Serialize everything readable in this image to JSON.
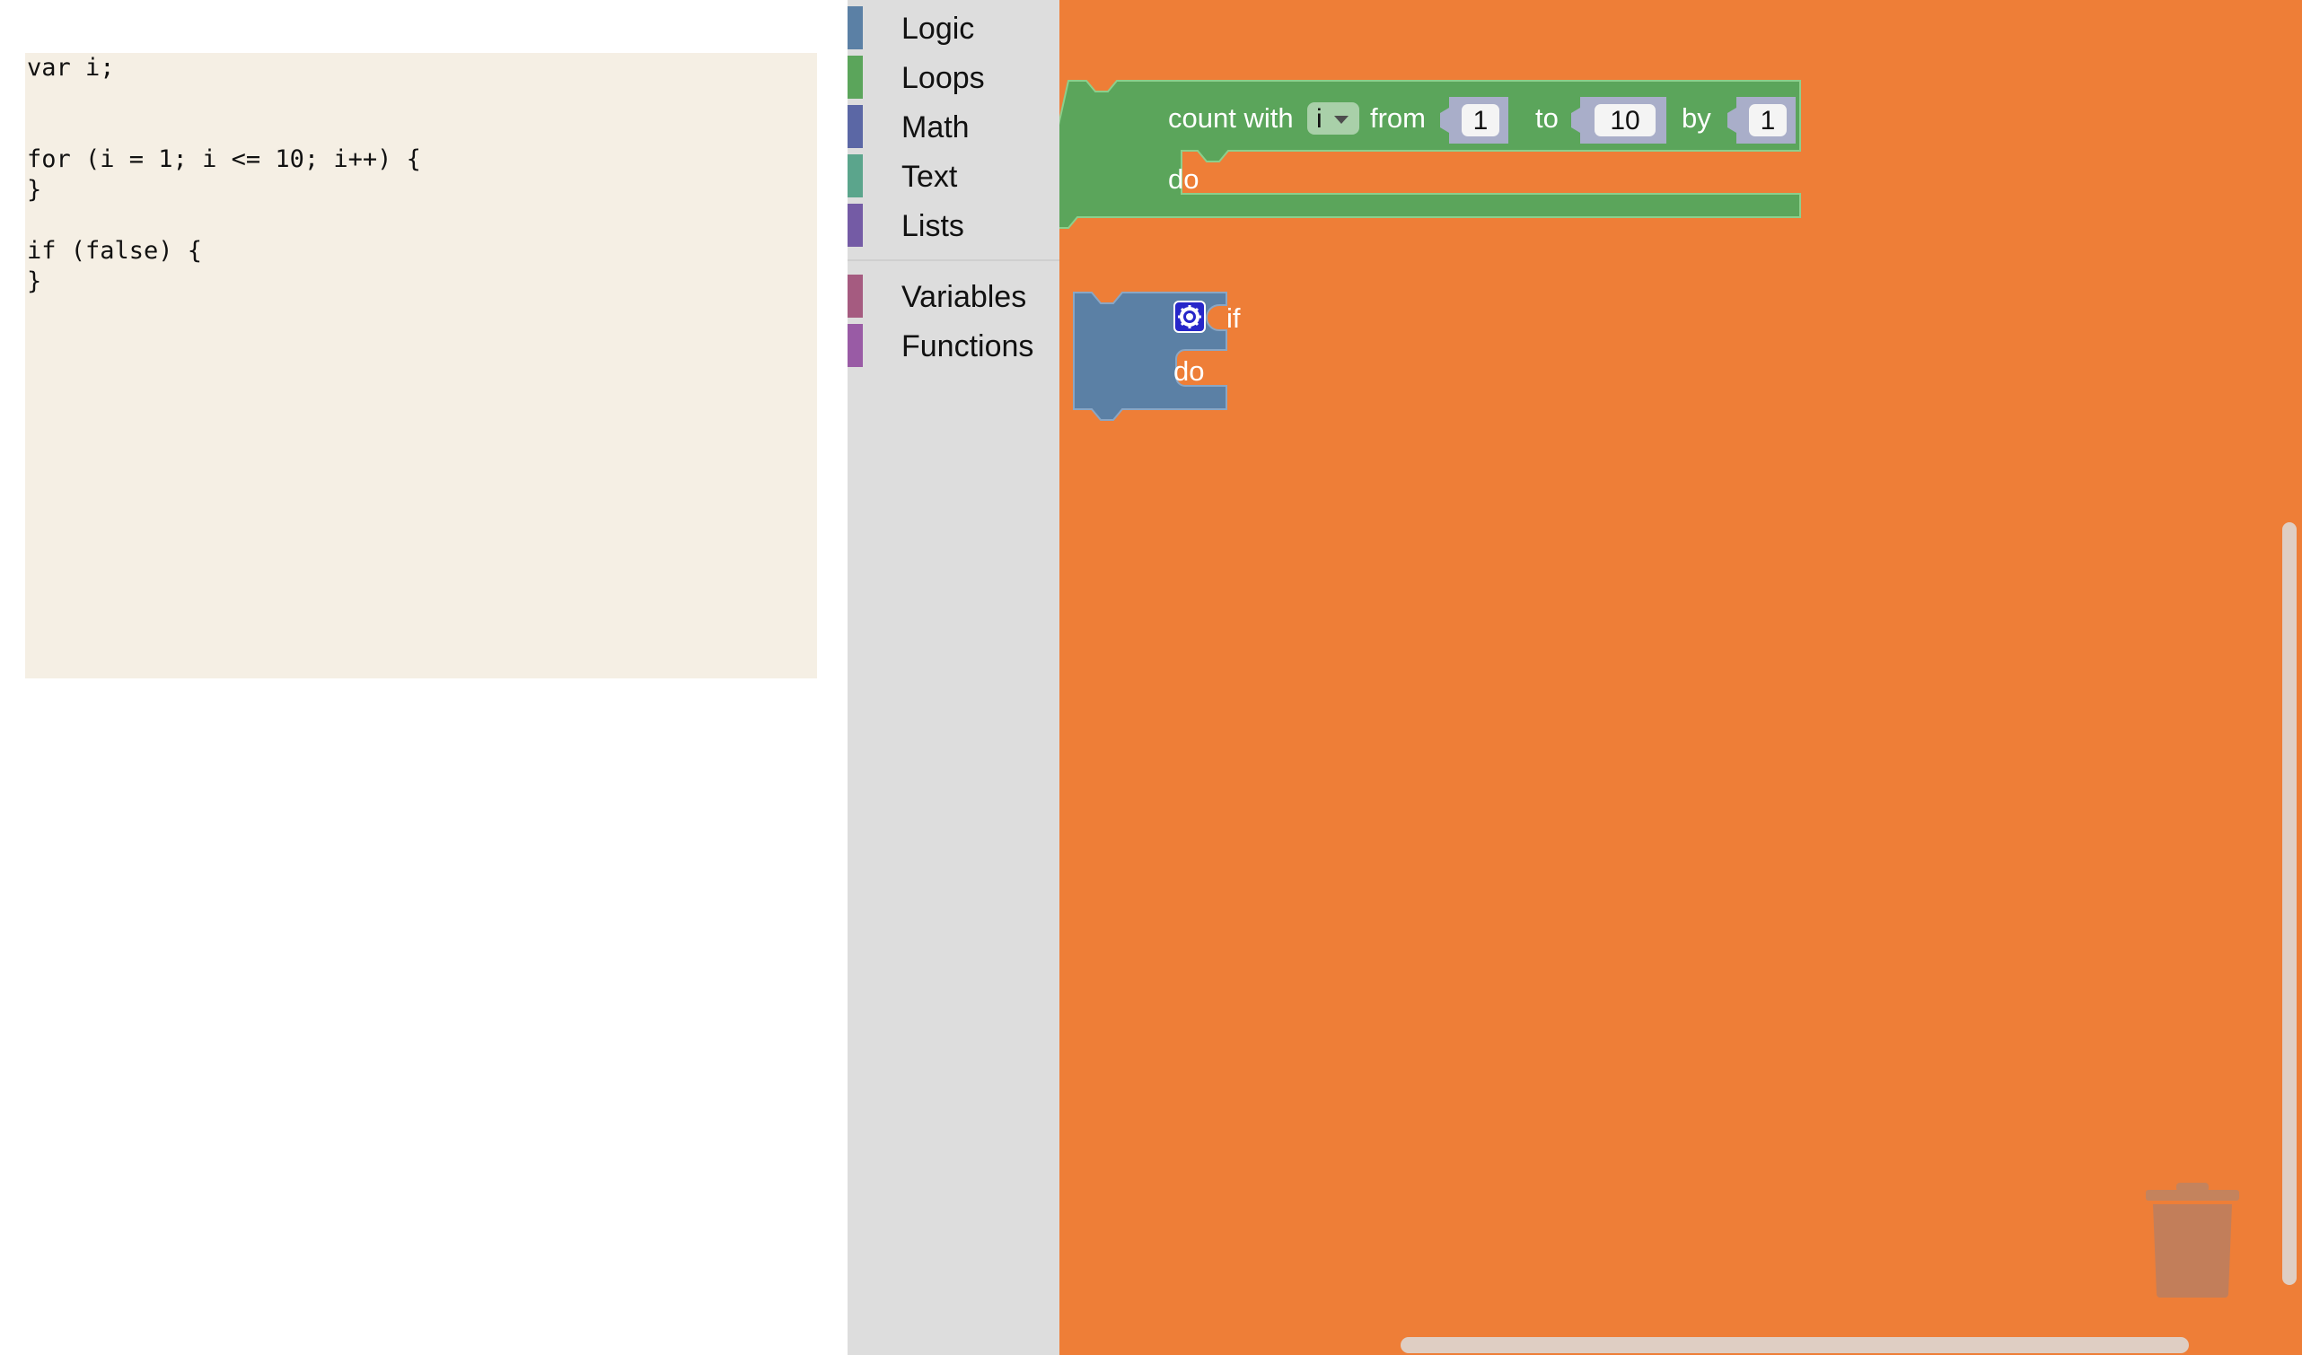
{
  "code": {
    "lines": [
      "var i;",
      "",
      "",
      "for (i = 1; i <= 10; i++) {",
      "}",
      "",
      "if (false) {",
      "}"
    ]
  },
  "toolbox": {
    "categories": [
      {
        "label": "Logic",
        "color": "#5b80a5"
      },
      {
        "label": "Loops",
        "color": "#5ba55b"
      },
      {
        "label": "Math",
        "color": "#5b67a5"
      },
      {
        "label": "Text",
        "color": "#5ba58c"
      },
      {
        "label": "Lists",
        "color": "#745ba5"
      },
      {
        "label": "Variables",
        "color": "#a55b80"
      },
      {
        "label": "Functions",
        "color": "#995ba5"
      }
    ]
  },
  "workspace": {
    "background": "#ee7e37",
    "for_block": {
      "color": "#5ba55b",
      "label_count_with": "count with",
      "variable": "i",
      "label_from": "from",
      "from_value": "1",
      "label_to": "to",
      "to_value": "10",
      "label_by": "by",
      "by_value": "1",
      "label_do": "do"
    },
    "if_block": {
      "color": "#5b80a5",
      "label_if": "if",
      "label_do": "do",
      "mutator_icon": "gear-icon"
    },
    "trash_icon": "trash-can-icon"
  }
}
